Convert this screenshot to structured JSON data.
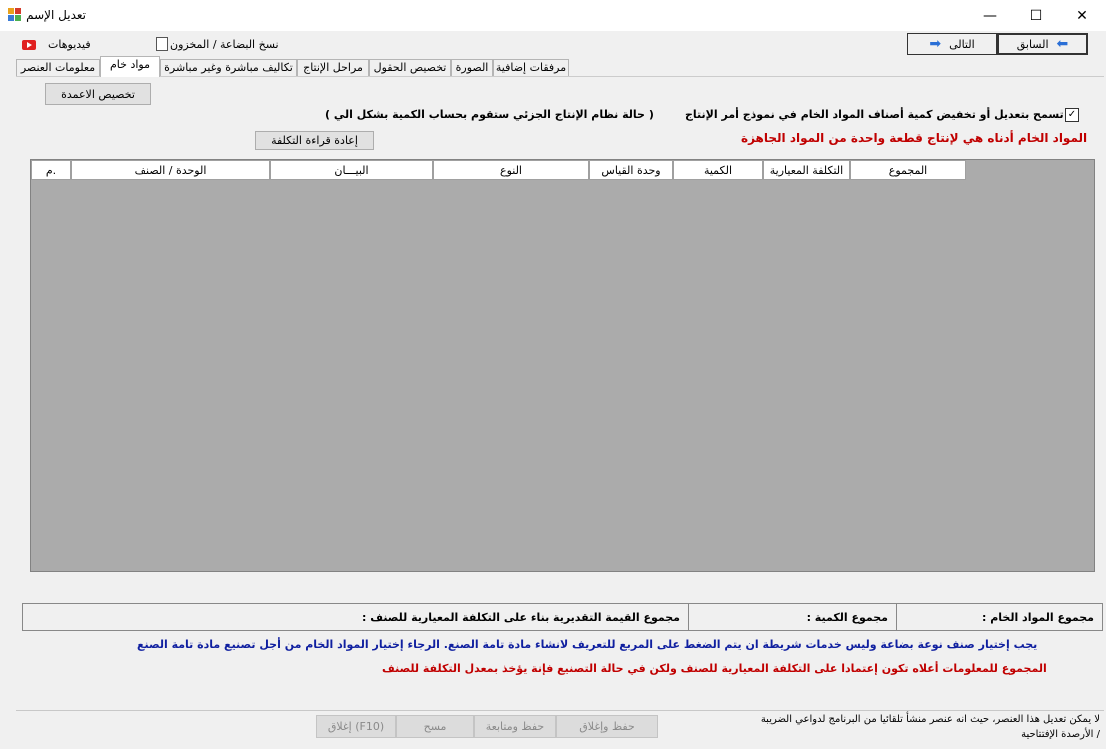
{
  "window": {
    "title": "تعديل الإسم",
    "minimize_glyph": "—",
    "maximize_glyph": "☐",
    "close_glyph": "✕"
  },
  "toolbar": {
    "videos_label": "فيديوهات",
    "copy_label": "نسخ البضاعة / المخزون",
    "prev_label": "السابق",
    "next_label": "التالى"
  },
  "icons": {
    "app": "app-icon",
    "videos": "youtube-icon",
    "copy": "copy-document-icon",
    "prev": "arrow-left-icon",
    "next": "arrow-right-icon",
    "check": "check-icon"
  },
  "tabs": [
    {
      "label": "معلومات العنصر"
    },
    {
      "label": "مواد خام"
    },
    {
      "label": "تكاليف مباشرة وغير مباشرة"
    },
    {
      "label": "مراحل الإنتاج"
    },
    {
      "label": "تخصيص الحقول"
    },
    {
      "label": "الصورة"
    },
    {
      "label": "مرفقات إضافية"
    }
  ],
  "panel": {
    "customize_columns": "تخصيص الاعمدة",
    "partial_note": "( حالة نظام الإنتاج الجزئي ستقوم بحساب الكمية بشكل الي )",
    "no_change_label": "لا تسمح بتعديل أو تخفيض كمية أصناف المواد الخام في نموذج أمر الإنتاج",
    "no_change_checked": true,
    "check_glyph": "✓",
    "reread_cost": "إعادة قراءة التكلفة",
    "red_note": "المواد الخام أدناه هي لإنتاج قطعة واحدة من المواد الجاهزة"
  },
  "grid": {
    "columns": [
      "المجموع",
      "التكلفة المعيارية",
      "الكمية",
      "وحدة القياس",
      "النوع",
      "البيـــان",
      "الوحدة / الصنف",
      "م."
    ],
    "rows": []
  },
  "totals": {
    "raw_total": "مجموع المواد الخام :",
    "qty_total": "مجموع الكمية :",
    "estimated_total": "مجموع القيمة التقديرية بناء على التكلفة المعيارية للصنف :"
  },
  "notes": {
    "blue": "يجب إختيار صنف نوعة بضاعة وليس خدمات شريطة ان يتم الضغط على المربع للتعريف لانشاء مادة تامة الصنع. الرجاء إختيار المواد الخام من أجل تصنيع مادة تامة الصنع",
    "red": "المجموع للمعلومات أعلاه تكون إعتمادا على التكلفة المعيارية للصنف ولكن في حالة التصنيع فإنة يؤخذ بمعدل التكلفة للصنف"
  },
  "bottom": {
    "save_close": "حفظ وإغلاق",
    "save_continue": "حفظ ومتابعة",
    "clear": "مسح",
    "close": "إغلاق (F10)",
    "footer_note": "لا يمكن تعديل هذا العنصر، حيث انه عنصر منشأ تلقائيا من البرنامج لدواعي الضريبة / الأرصدة الإفتتاحية"
  }
}
